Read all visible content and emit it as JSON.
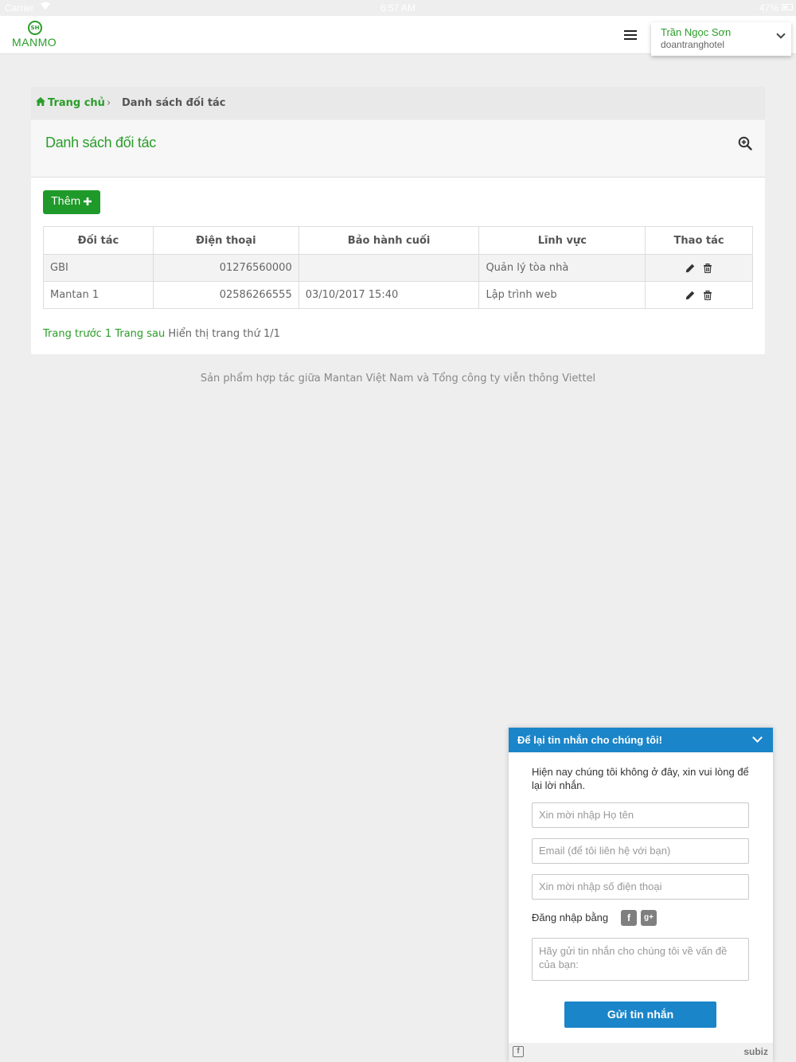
{
  "status_bar": {
    "carrier": "Carrier",
    "time": "6:57 AM",
    "battery": "47%"
  },
  "header": {
    "logo_text": "MANMO",
    "logo_badge": "SH",
    "user_name": "Trần Ngọc Sơn",
    "user_login": "doantranghotel"
  },
  "breadcrumb": {
    "home": "Trang chủ",
    "current": "Danh sách đối tác"
  },
  "panel": {
    "title": "Danh sách đối tác",
    "add_label": "Thêm"
  },
  "table": {
    "columns": [
      "Đối tác",
      "Điện thoại",
      "Bảo hành cuối",
      "Lĩnh vực",
      "Thao tác"
    ],
    "rows": [
      {
        "partner": "GBI",
        "phone": "01276560000",
        "warranty": "",
        "field": "Quản lý tòa nhà"
      },
      {
        "partner": "Mantan 1",
        "phone": "02586266555",
        "warranty": "03/10/2017 15:40",
        "field": "Lập trình web"
      }
    ]
  },
  "pager": {
    "prev": "Trang trước",
    "page": "1",
    "next": "Trang sau",
    "info": "Hiển thị trang thứ 1/1"
  },
  "footer": {
    "note": "Sản phẩm hợp tác giữa Mantan Việt Nam và Tổng công ty viễn thông Viettel"
  },
  "chat": {
    "title": "Để lại tin nhắn cho chúng tôi!",
    "message": "Hiện nay chúng tôi không ở đây, xin vui lòng để lại lời nhắn.",
    "name_placeholder": "Xin mời nhập Họ tên",
    "email_placeholder": "Email (để tôi liên hệ với bạn)",
    "phone_placeholder": "Xin mời nhập số điện thoại",
    "login_label": "Đăng nhập bằng",
    "message_placeholder": "Hãy gửi tin nhắn cho chúng tôi về vấn đề của bạn:",
    "send_label": "Gửi tin nhắn",
    "brand": "subiz"
  },
  "colors": {
    "brand_green": "#2a9d2a",
    "button_green": "#1f9a2a",
    "chat_blue": "#1b85c9"
  }
}
